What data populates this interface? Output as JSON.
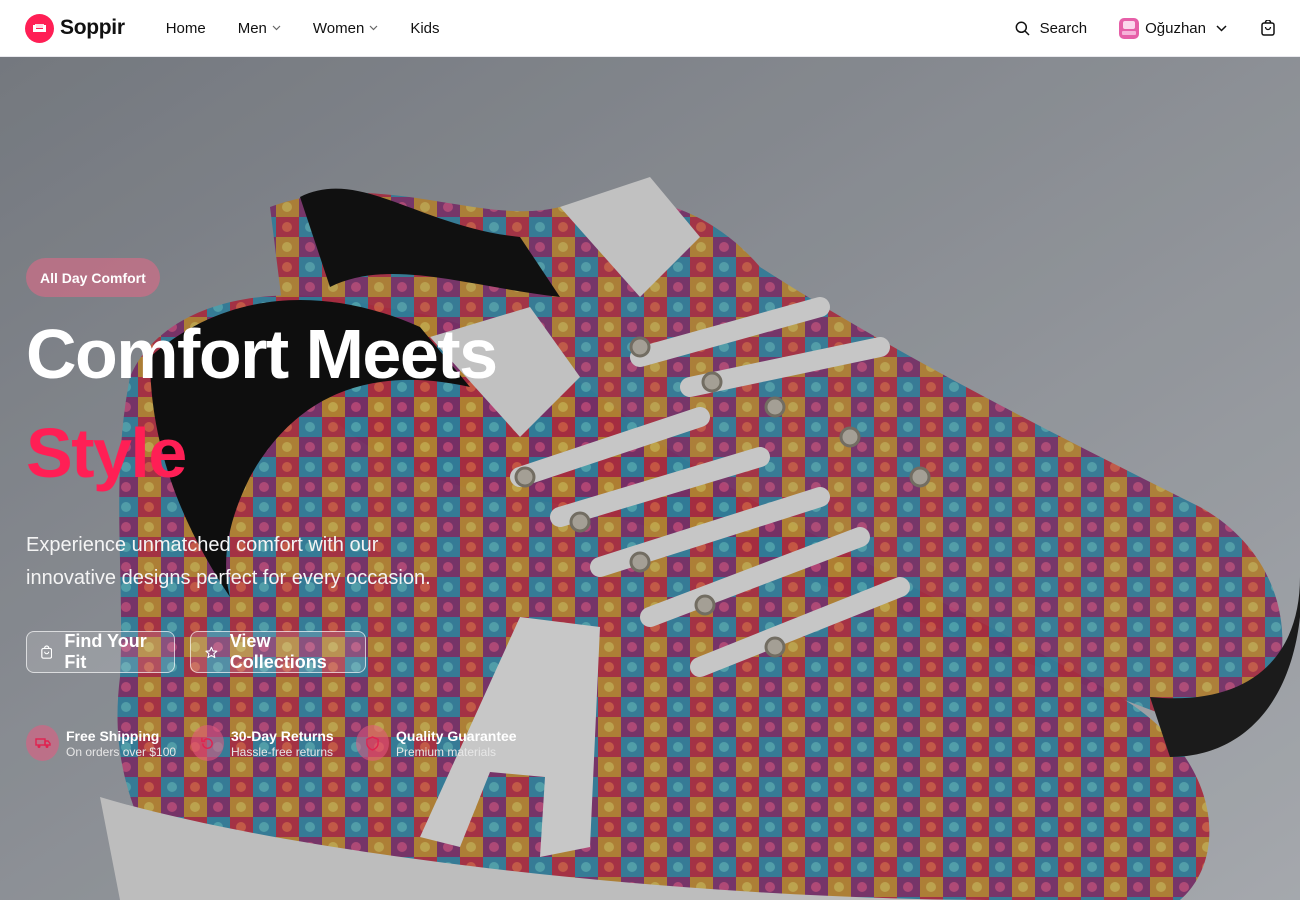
{
  "brand": {
    "name": "Soppir",
    "accent_color": "#ff1f55",
    "logo_icon": "sofa-icon"
  },
  "nav": {
    "links": [
      {
        "label": "Home",
        "has_dropdown": false
      },
      {
        "label": "Men",
        "has_dropdown": true
      },
      {
        "label": "Women",
        "has_dropdown": true
      },
      {
        "label": "Kids",
        "has_dropdown": false
      }
    ],
    "search_label": "Search",
    "user_name": "Oğuzhan",
    "cart_icon": "shopping-bag-icon"
  },
  "hero": {
    "badge": "All Day Comfort",
    "headline_line1": "Comfort Meets",
    "headline_line2": "Style",
    "description": "Experience unmatched comfort with our innovative designs perfect for every occasion.",
    "primary_button": "Find Your Fit",
    "secondary_button": "View Collections",
    "background_image": "colorful snakeskin-patterned sneakers"
  },
  "features": [
    {
      "title": "Free Shipping",
      "subtitle": "On orders over $100",
      "icon": "truck-icon"
    },
    {
      "title": "30-Day Returns",
      "subtitle": "Hassle-free returns",
      "icon": "return-icon"
    },
    {
      "title": "Quality Guarantee",
      "subtitle": "Premium materials",
      "icon": "shield-icon"
    }
  ]
}
